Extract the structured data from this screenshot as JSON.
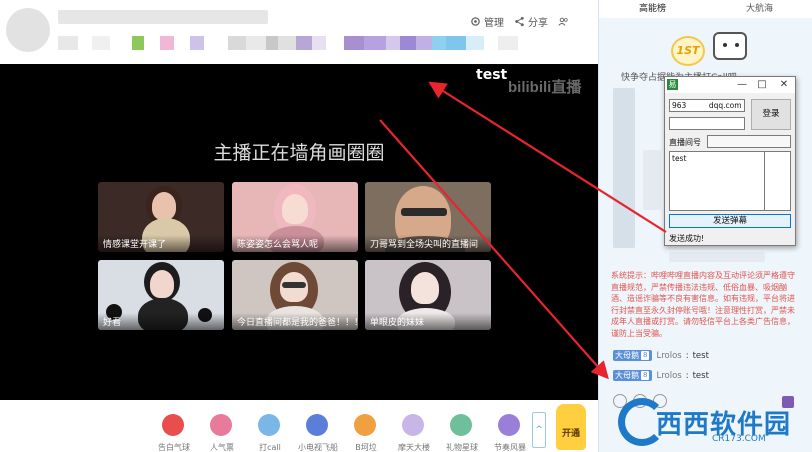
{
  "header": {
    "actions": [
      {
        "icon": "gear-icon",
        "label": "管理"
      },
      {
        "icon": "share-icon",
        "label": "分享"
      },
      {
        "icon": "users-icon",
        "label": ""
      }
    ]
  },
  "video": {
    "danmu_text": "test",
    "logo": "bilibili直播",
    "status_title": "主播正在墙角画圈圈",
    "recommendations": [
      {
        "caption": "情感课堂开课了"
      },
      {
        "caption": "陈姿姿怎么会骂人呢"
      },
      {
        "caption": "刀哥骂到全场尖叫的直播间"
      },
      {
        "caption": "好看"
      },
      {
        "caption": "今日直播间都是我的爸爸！！！"
      },
      {
        "caption": "单眼皮的妹妹"
      }
    ]
  },
  "giftbar": {
    "gifts": [
      {
        "label": "告白气球",
        "color": "#e84e4e"
      },
      {
        "label": "人气票",
        "color": "#e87a9a"
      },
      {
        "label": "打call",
        "color": "#7ab6e8"
      },
      {
        "label": "小电视飞船",
        "color": "#5b7fd8"
      },
      {
        "label": "B坷垃",
        "color": "#f0a040"
      },
      {
        "label": "摩天大楼",
        "color": "#c9b6e8"
      },
      {
        "label": "礼物星球",
        "color": "#6fbf9a"
      },
      {
        "label": "节奏风暴",
        "color": "#9a7fd8"
      }
    ],
    "scroll_label": "^",
    "mascot_label": "开通"
  },
  "sidebar": {
    "tabs": [
      {
        "label": "高能榜",
        "active": true
      },
      {
        "label": "大航海",
        "active": false
      }
    ],
    "rank_badge": "1ST",
    "rank_text": "快争夺占据能为主播打Call吧",
    "system_notice": "系统提示：哔哩哔哩直播内容及互动评论须严格遵守直播规范，严禁传播违法违规、低俗血暴、吸烟酗酒、造谣诈骗等不良有害信息。如有违规，平台将进行封禁直至永久封停账号哦！注意理性打赏，严禁未成年人直播或打赏。请勿轻信平台上各类广告信息，谨防上当受骗。",
    "chat": [
      {
        "badge": "大母鹅",
        "level": "8",
        "user": "Lrolos",
        "message": "test"
      },
      {
        "badge": "大母鹅",
        "level": "8",
        "user": "Lrolos",
        "message": "test"
      }
    ],
    "watermark": {
      "text": "西西软件园",
      "url": "CR173.COM"
    }
  },
  "dialog": {
    "app_icon": "易",
    "minimize": "—",
    "maximize": "□",
    "close": "✕",
    "account_value": "963      dqq.com",
    "login_label": "登录",
    "room_label": "直播间号",
    "message_value": "test",
    "send_label": "发送弹幕",
    "status": "发送成功!"
  },
  "colors": {
    "accent": "#23ade5",
    "notice_red": "#e0564f",
    "arrow_red": "#e8242f",
    "badge_blue": "#5b8fd8",
    "watermark_blue": "#1e7ac8"
  }
}
